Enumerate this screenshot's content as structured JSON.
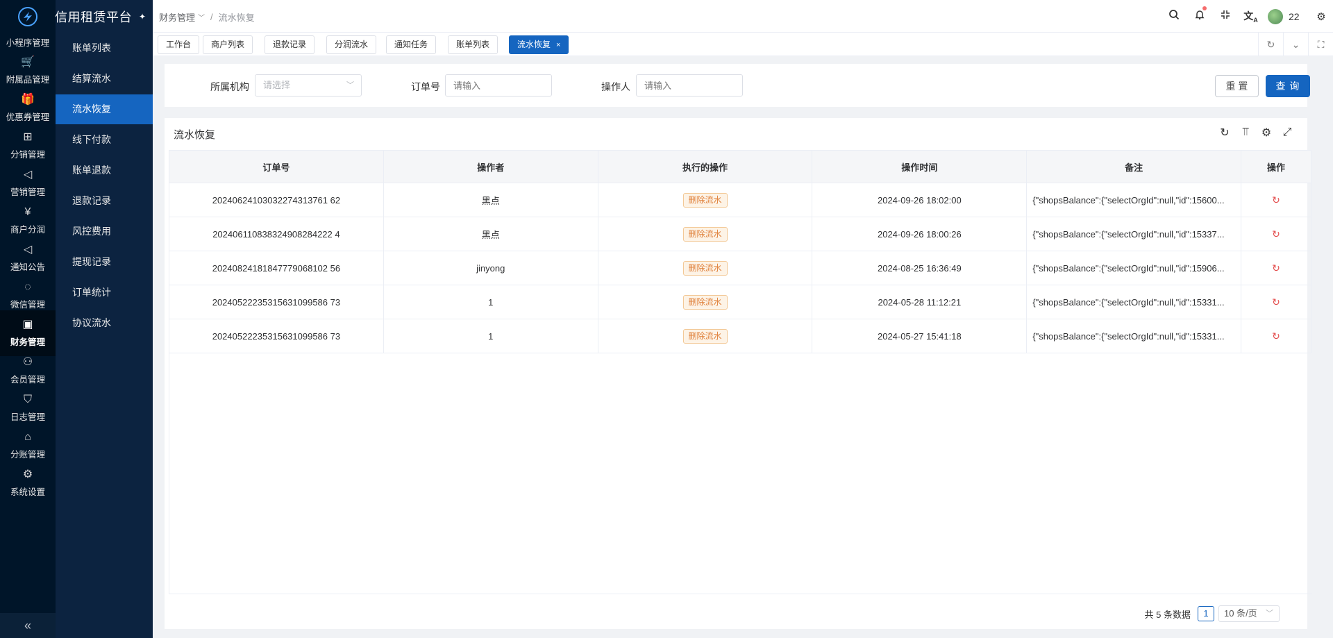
{
  "app": {
    "title": "信用租赁平台"
  },
  "rail": {
    "items": [
      {
        "label": "小程序管理",
        "icon": "miniapp-icon",
        "glyph": ""
      },
      {
        "label": "附属品管理",
        "icon": "cart-icon",
        "glyph": "🛒"
      },
      {
        "label": "优惠券管理",
        "icon": "gift-icon",
        "glyph": "🎁"
      },
      {
        "label": "分销管理",
        "icon": "distribution-icon",
        "glyph": "⊞"
      },
      {
        "label": "营销管理",
        "icon": "megaphone-icon",
        "glyph": "◁"
      },
      {
        "label": "商户分润",
        "icon": "yen-icon",
        "glyph": "¥"
      },
      {
        "label": "通知公告",
        "icon": "notice-icon",
        "glyph": "◁"
      },
      {
        "label": "微信管理",
        "icon": "wechat-icon",
        "glyph": "◌"
      },
      {
        "label": "财务管理",
        "icon": "finance-icon",
        "glyph": "▣"
      },
      {
        "label": "会员管理",
        "icon": "member-icon",
        "glyph": "⚇"
      },
      {
        "label": "日志管理",
        "icon": "log-shield-icon",
        "glyph": "⛉"
      },
      {
        "label": "分账管理",
        "icon": "split-icon",
        "glyph": "⌂"
      },
      {
        "label": "系统设置",
        "icon": "settings-icon",
        "glyph": "⚙"
      }
    ],
    "collapse_glyph": "«"
  },
  "submenu": {
    "items": [
      "账单列表",
      "结算流水",
      "流水恢复",
      "线下付款",
      "账单退款",
      "退款记录",
      "风控费用",
      "提现记录",
      "订单统计",
      "协议流水"
    ]
  },
  "header": {
    "breadcrumb": [
      "财务管理",
      "流水恢复"
    ],
    "user": "22"
  },
  "tabs": [
    "工作台",
    "商户列表",
    "退款记录",
    "分润流水",
    "通知任务",
    "账单列表",
    "流水恢复"
  ],
  "search": {
    "org_label": "所属机构",
    "org_placeholder": "请选择",
    "order_label": "订单号",
    "order_placeholder": "请输入",
    "operator_label": "操作人",
    "operator_placeholder": "请输入",
    "reset": "重 置",
    "query": "查 询"
  },
  "table": {
    "title": "流水恢复",
    "columns": [
      "订单号",
      "操作者",
      "执行的操作",
      "操作时间",
      "备注",
      "操作"
    ],
    "rows": [
      {
        "order": "20240624103032274313761 62",
        "operator": "黑点",
        "action": "删除流水",
        "time": "2024-09-26 18:02:00",
        "note": "{\"shopsBalance\":{\"selectOrgId\":null,\"id\":15600..."
      },
      {
        "order": "202406110838324908284222 4",
        "operator": "黑点",
        "action": "删除流水",
        "time": "2024-09-26 18:00:26",
        "note": "{\"shopsBalance\":{\"selectOrgId\":null,\"id\":15337..."
      },
      {
        "order": "20240824181847779068102 56",
        "operator": "jinyong",
        "action": "删除流水",
        "time": "2024-08-25 16:36:49",
        "note": "{\"shopsBalance\":{\"selectOrgId\":null,\"id\":15906..."
      },
      {
        "order": "20240522235315631099586 73",
        "operator": "1",
        "action": "删除流水",
        "time": "2024-05-28 11:12:21",
        "note": "{\"shopsBalance\":{\"selectOrgId\":null,\"id\":15331..."
      },
      {
        "order": "20240522235315631099586 73",
        "operator": "1",
        "action": "删除流水",
        "time": "2024-05-27 15:41:18",
        "note": "{\"shopsBalance\":{\"selectOrgId\":null,\"id\":15331..."
      }
    ]
  },
  "pager": {
    "total": "共 5 条数据",
    "page": "1",
    "size": "10 条/页"
  },
  "colors": {
    "primary": "#1565c0",
    "sidebar": "#001529",
    "tag": "#e0823d",
    "restore": "#e34b4b"
  }
}
